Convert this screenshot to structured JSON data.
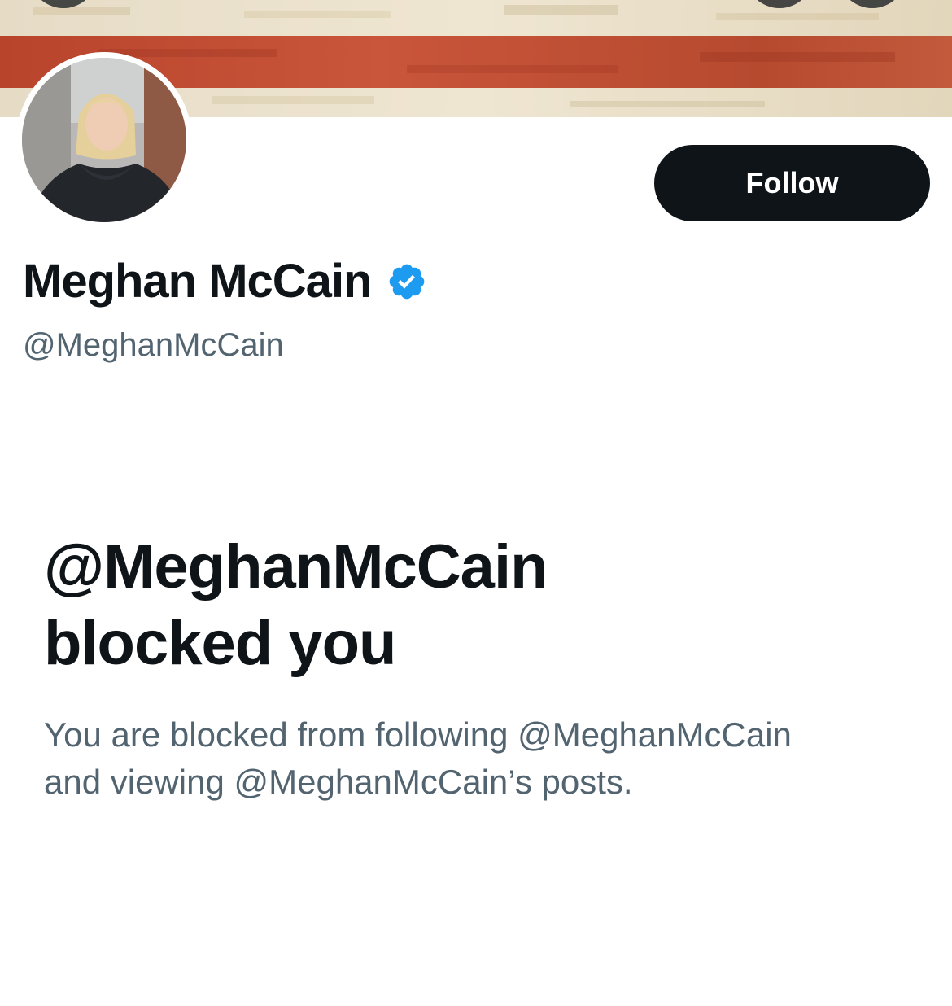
{
  "profile": {
    "display_name": "Meghan McCain",
    "verified_icon": "verified-badge-icon",
    "handle": "@MeghanMcCain",
    "follow_label": "Follow"
  },
  "blocked": {
    "title_line1": "@MeghanMcCain",
    "title_line2": "blocked you",
    "description_line1": "You are blocked from following @MeghanMcCain",
    "description_line2": "and viewing @MeghanMcCain’s posts."
  },
  "colors": {
    "primary_text": "#0f1419",
    "secondary_text": "#536471",
    "verified_blue": "#1d9bf0",
    "button_bg": "#0f1419"
  }
}
